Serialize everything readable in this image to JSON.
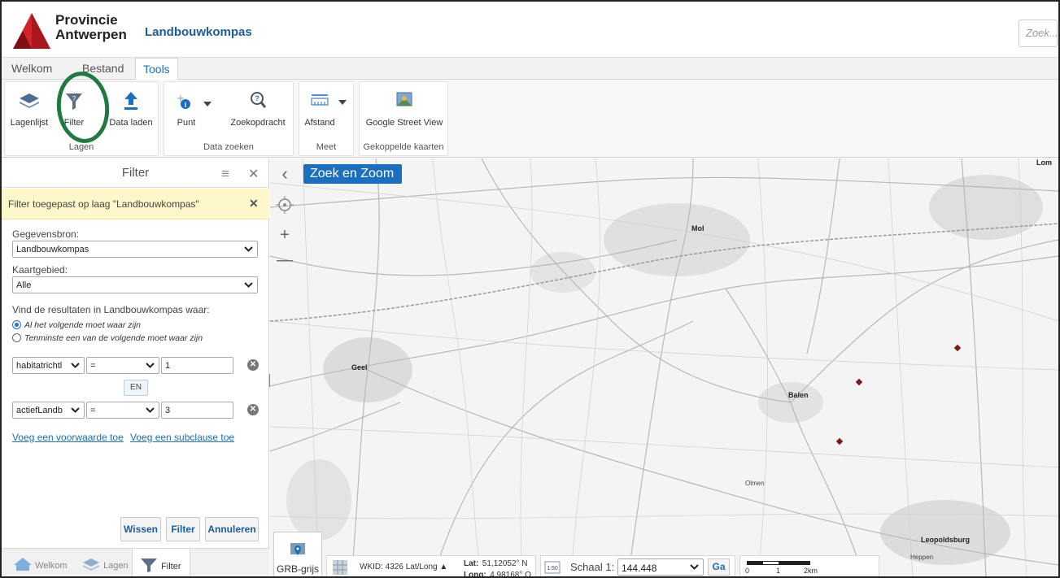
{
  "header": {
    "org_name_line1": "Provincie",
    "org_name_line2": "Antwerpen",
    "app_title": "Landbouwkompas",
    "search_placeholder": "Zoek..."
  },
  "tabs": [
    "Welkom",
    "Bestand",
    "Tools"
  ],
  "active_tab": "Tools",
  "ribbon": {
    "groups": [
      {
        "label": "Lagen",
        "buttons": [
          "Lagenlijst",
          "Filter",
          "Data laden"
        ]
      },
      {
        "label": "Data zoeken",
        "buttons": [
          "Punt",
          "Zoekopdracht"
        ]
      },
      {
        "label": "Meet",
        "buttons": [
          "Afstand"
        ]
      },
      {
        "label": "Gekoppelde kaarten",
        "buttons": [
          "Google Street View"
        ]
      }
    ]
  },
  "panel": {
    "title": "Filter",
    "notice": "Filter toegepast op laag \"Landbouwkompas\"",
    "source_label": "Gegevensbron:",
    "source_value": "Landbouwkompas",
    "area_label": "Kaartgebied:",
    "area_value": "Alle",
    "find_text": "Vind de resultaten in Landbouwkompas waar:",
    "radio_all": "Al het volgende moet waar zijn",
    "radio_any": "Tenminste een van de volgende moet waar zijn",
    "conditions": [
      {
        "field": "habitatrichtl",
        "operator": "=",
        "value": "1"
      },
      {
        "field": "actiefLandb",
        "operator": "=",
        "value": "3"
      }
    ],
    "joiner": "EN",
    "add_condition": "Voeg een voorwaarde toe",
    "add_subclause": "Voeg een subclause toe",
    "btn_clear": "Wissen",
    "btn_filter": "Filter",
    "btn_cancel": "Annuleren",
    "bottom_tabs": [
      "Welkom",
      "Lagen",
      "Filter"
    ]
  },
  "map": {
    "zoom_button": "Zoek en Zoom",
    "places": [
      "Mol",
      "Geel",
      "Balen",
      "Olmen",
      "Leopoldsburg",
      "Heppen",
      "Lom"
    ],
    "basemap_label": "GRB-grijs",
    "wkid_text": "WKID: 4326 Lat/Long",
    "lat_label": "Lat:",
    "lat_value": "51,12052° N",
    "long_label": "Long:",
    "long_value": "4,98168° O",
    "scale_label": "Schaal 1:",
    "scale_value": "144.448",
    "go_button": "Ga",
    "scalebar_labels": [
      "0",
      "1",
      "2km"
    ]
  },
  "colors": {
    "accent": "#1b6fbf",
    "logo_red": "#d1232a",
    "annotation_green": "#1f7a3f",
    "notice_bg": "#fdf7c9",
    "marker": "#7a1a1a"
  }
}
